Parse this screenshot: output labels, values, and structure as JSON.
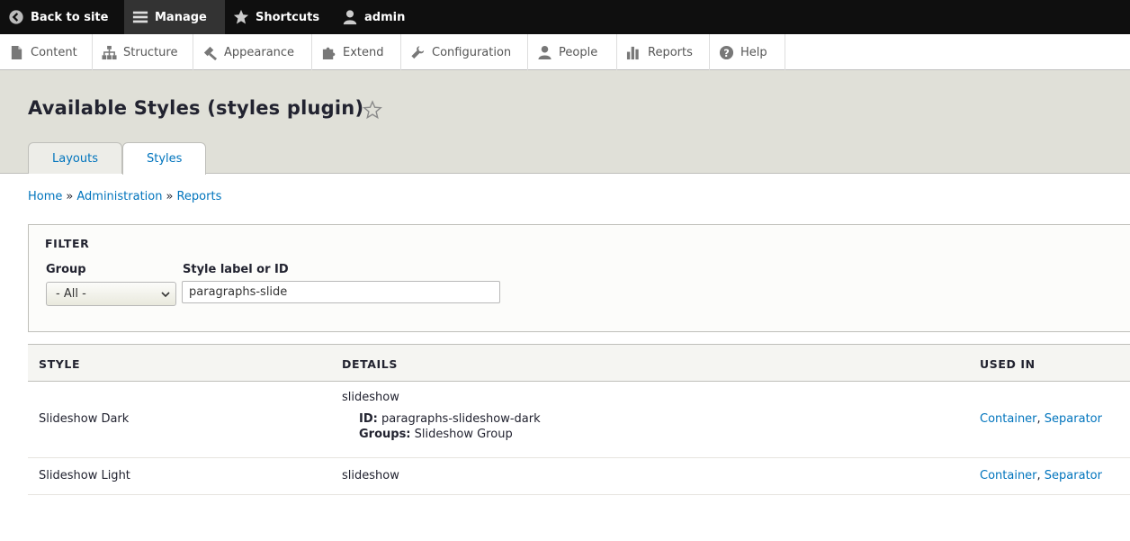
{
  "toolbar": {
    "back": "Back to site",
    "manage": "Manage",
    "shortcuts": "Shortcuts",
    "user": "admin"
  },
  "tray": {
    "items": [
      "Content",
      "Structure",
      "Appearance",
      "Extend",
      "Configuration",
      "People",
      "Reports",
      "Help"
    ]
  },
  "page": {
    "title": "Available Styles (styles plugin)",
    "tabs": [
      "Layouts",
      "Styles"
    ]
  },
  "breadcrumb": {
    "items": [
      "Home",
      "Administration",
      "Reports"
    ],
    "separator": "»"
  },
  "filter": {
    "legend": "FILTER",
    "group_label": "Group",
    "group_value": "- All -",
    "search_label": "Style label or ID",
    "search_value": "paragraphs-slide"
  },
  "table": {
    "headers": [
      "STYLE",
      "DETAILS",
      "USED IN"
    ],
    "rows": [
      {
        "style": "Slideshow Dark",
        "details_title": "slideshow",
        "id_label": "ID:",
        "id_value": "paragraphs-slideshow-dark",
        "groups_label": "Groups:",
        "groups_value": "Slideshow Group",
        "used_in": [
          "Container",
          "Separator"
        ],
        "used_sep": ", "
      },
      {
        "style": "Slideshow Light",
        "details_title": "slideshow",
        "used_in": [
          "Container",
          "Separator"
        ],
        "used_sep": ", "
      }
    ]
  }
}
